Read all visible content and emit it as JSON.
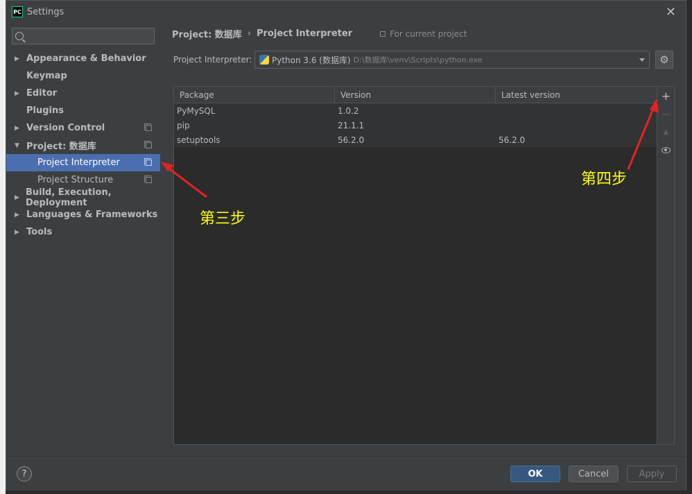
{
  "window": {
    "title": "Settings",
    "app_icon_text": "PC"
  },
  "sidebar": {
    "search_placeholder": "",
    "items": [
      {
        "label": "Appearance & Behavior",
        "arrow": "▶"
      },
      {
        "label": "Keymap"
      },
      {
        "label": "Editor",
        "arrow": "▶"
      },
      {
        "label": "Plugins"
      },
      {
        "label": "Version Control",
        "arrow": "▶"
      },
      {
        "label": "Project: 数据库",
        "arrow": "▼"
      },
      {
        "label": "Project Interpreter"
      },
      {
        "label": "Project Structure"
      },
      {
        "label": "Build, Execution, Deployment",
        "arrow": "▶"
      },
      {
        "label": "Languages & Frameworks",
        "arrow": "▶"
      },
      {
        "label": "Tools",
        "arrow": "▶"
      }
    ]
  },
  "main": {
    "breadcrumb": {
      "parent": "Project: 数据库",
      "separator": "›",
      "current": "Project Interpreter"
    },
    "scope": "For current project",
    "interpreter_label": "Project Interpreter:",
    "interpreter_name": "Python 3.6 (数据库)",
    "interpreter_path": "D:\\数据库\\venv\\Scripts\\python.exe",
    "gear": "⚙"
  },
  "table": {
    "headers": [
      "Package",
      "Version",
      "Latest version"
    ],
    "rows": [
      {
        "package": "PyMySQL",
        "version": "1.0.2",
        "latest": ""
      },
      {
        "package": "pip",
        "version": "21.1.1",
        "latest": ""
      },
      {
        "package": "setuptools",
        "version": "56.2.0",
        "latest": "56.2.0"
      }
    ],
    "toolbar": {
      "add": "+",
      "remove": "−",
      "upgrade": "▲"
    }
  },
  "annotations": {
    "step3": "第三步",
    "step4": "第四步",
    "color": "#ffff00"
  },
  "footer": {
    "help": "?",
    "ok": "OK",
    "cancel": "Cancel",
    "apply": "Apply"
  }
}
